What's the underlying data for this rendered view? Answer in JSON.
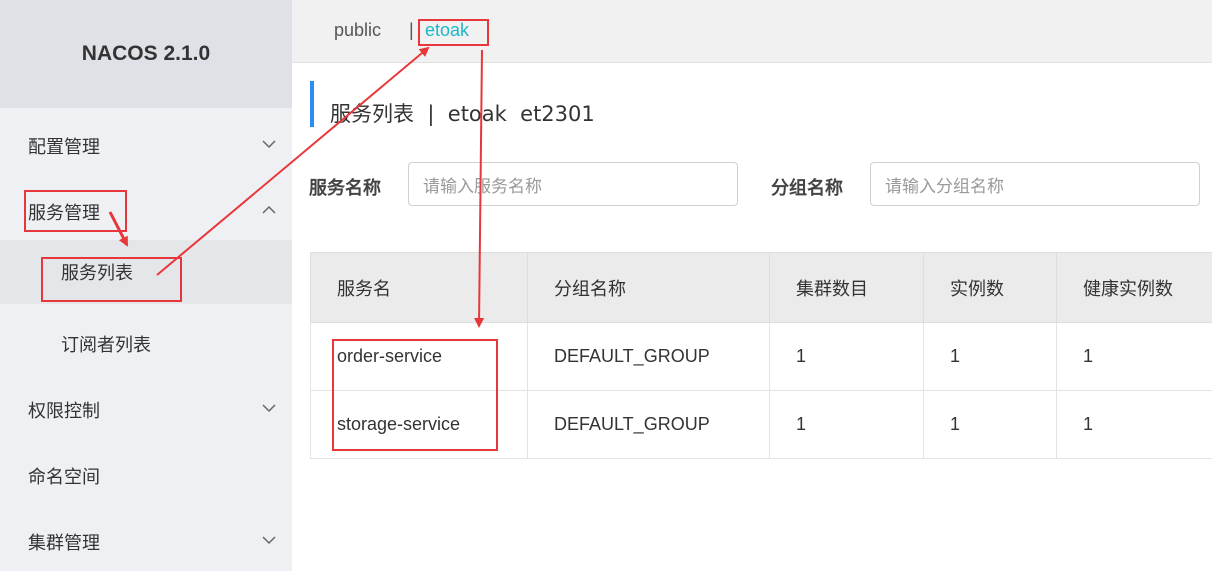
{
  "brand": "NACOS 2.1.0",
  "sidebar": {
    "items": [
      {
        "label": "配置管理",
        "expanded": false
      },
      {
        "label": "服务管理",
        "expanded": true
      },
      {
        "label": "权限控制",
        "expanded": false
      },
      {
        "label": "命名空间"
      },
      {
        "label": "集群管理",
        "expanded": false
      }
    ],
    "subitems": [
      {
        "label": "服务列表",
        "active": true
      },
      {
        "label": "订阅者列表",
        "active": false
      }
    ]
  },
  "namespaces": {
    "public": "public",
    "separator": "|",
    "current": "etoak"
  },
  "page": {
    "title": "服务列表  |  etoak  et2301"
  },
  "search": {
    "service_name_label": "服务名称",
    "service_name_placeholder": "请输入服务名称",
    "group_name_label": "分组名称",
    "group_name_placeholder": "请输入分组名称"
  },
  "table": {
    "headers": [
      "服务名",
      "分组名称",
      "集群数目",
      "实例数",
      "健康实例数"
    ],
    "rows": [
      [
        "order-service",
        "DEFAULT_GROUP",
        "1",
        "1",
        "1"
      ],
      [
        "storage-service",
        "DEFAULT_GROUP",
        "1",
        "1",
        "1"
      ]
    ]
  },
  "colors": {
    "accent": "#1bb8cc",
    "title_bar": "#2d8cf0",
    "annotation": "#e8373a"
  }
}
